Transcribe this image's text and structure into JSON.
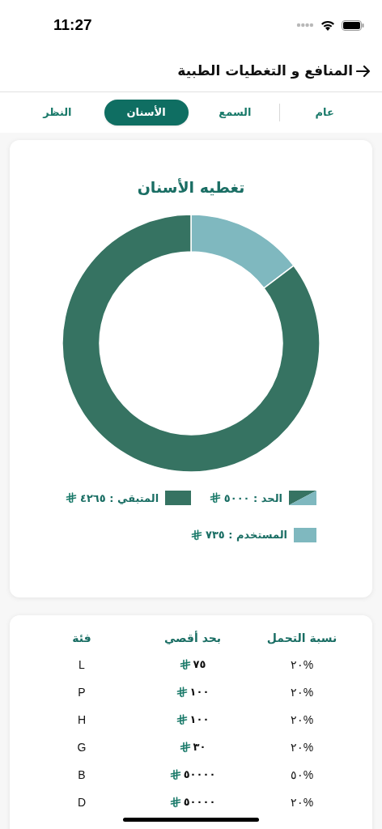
{
  "status_bar": {
    "time": "11:27"
  },
  "header": {
    "title": "المنافع و التغطيات الطبية"
  },
  "tabs": [
    {
      "label": "عام",
      "selected": false
    },
    {
      "label": "السمع",
      "selected": false
    },
    {
      "label": "الأسنان",
      "selected": true
    },
    {
      "label": "النظر",
      "selected": false
    }
  ],
  "coverage_card": {
    "title": "تغطيه الأسنان",
    "chart_data": {
      "type": "donut",
      "values": [
        14.7,
        85.3
      ]
    },
    "legend": [
      {
        "label": "الحد : ٥٠٠٠",
        "kind": "limit"
      },
      {
        "label": "المتبقي : ٤٢٦٥",
        "kind": "swatch",
        "color": "#367362"
      },
      {
        "label": "المستخدم : ٧٣٥",
        "kind": "swatch",
        "color": "#7fb8bf"
      }
    ]
  },
  "table": {
    "columns": [
      "نسبة التحمل",
      "بحد أقصي",
      "فئة"
    ],
    "rows": [
      [
        "٢٠%",
        "٧٥",
        "L"
      ],
      [
        "٢٠%",
        "١٠٠",
        "P"
      ],
      [
        "٢٠%",
        "١٠٠",
        "H"
      ],
      [
        "٢٠%",
        "٣٠",
        "G"
      ],
      [
        "٥٠%",
        "٥٠٠٠٠",
        "B"
      ],
      [
        "٢٠%",
        "٥٠٠٠٠",
        "D"
      ]
    ]
  }
}
